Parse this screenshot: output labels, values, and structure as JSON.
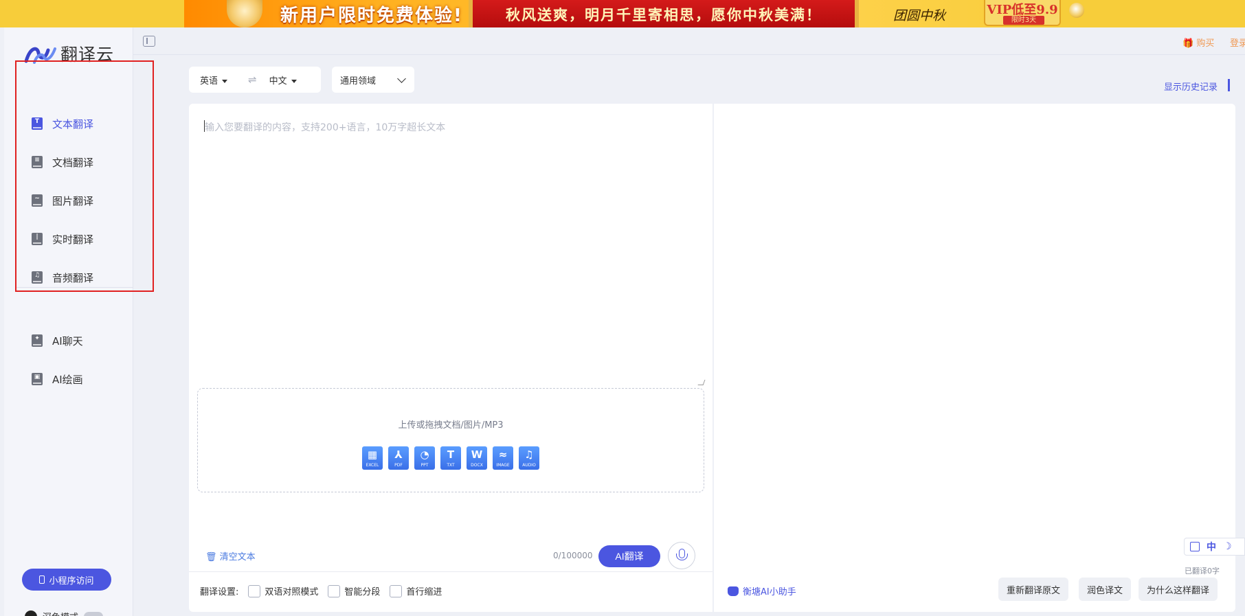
{
  "banner": {
    "title": "新用户限时免费体验!",
    "promo": "秋风送爽，明月千里寄相思，愿你中秋美满！",
    "logo": "团圆中秋",
    "vip": "VIP低至9.9",
    "vip_sub": "限时3天"
  },
  "topbar": {
    "buy": "🎁 购买",
    "login": "登录"
  },
  "app": {
    "name": "翻译云"
  },
  "sidebar": {
    "items": [
      {
        "label": "文本翻译",
        "icon": "txt-doc-icon",
        "glyph": "T"
      },
      {
        "label": "文档翻译",
        "icon": "document-icon",
        "glyph": "≡"
      },
      {
        "label": "图片翻译",
        "icon": "image-icon",
        "glyph": "~"
      },
      {
        "label": "实时翻译",
        "icon": "audio-wave-icon",
        "glyph": "|"
      },
      {
        "label": "音频翻译",
        "icon": "music-note-icon",
        "glyph": "♫"
      }
    ],
    "ai_items": [
      {
        "label": "AI聊天",
        "icon": "ai-chat-icon",
        "glyph": "✦"
      },
      {
        "label": "AI绘画",
        "icon": "ai-paint-icon",
        "glyph": "▣"
      }
    ],
    "mini_program": "小程序访问",
    "dark_mode": "深色模式"
  },
  "lang": {
    "source": "英语",
    "swap": "⇌",
    "target": "中文",
    "domain": "通用领域"
  },
  "history": "显示历史记录",
  "source_panel": {
    "placeholder": "输入您要翻译的内容，支持200+语言，10万字超长文本",
    "upload_text": "上传或拖拽文档/图片/MP3",
    "file_types": [
      {
        "label": "EXCEL",
        "glyph": "▦"
      },
      {
        "label": "PDF",
        "glyph": "⅄"
      },
      {
        "label": "PPT",
        "glyph": "◔"
      },
      {
        "label": "TXT",
        "glyph": "T"
      },
      {
        "label": "DOCX",
        "glyph": "W"
      },
      {
        "label": "IMAGE",
        "glyph": "≈"
      },
      {
        "label": "AUDIO",
        "glyph": "♫"
      }
    ],
    "clear": "🗑 清空文本",
    "count": "0/100000",
    "translate_btn": "AI翻译",
    "settings_label": "翻译设置:",
    "options": [
      "双语对照模式",
      "智能分段",
      "首行缩进"
    ]
  },
  "target_panel": {
    "tools": [
      "中",
      "☽"
    ],
    "translated_count": "已翻译0字",
    "assistant": "衡塘AI小助手",
    "buttons": [
      "重新翻译原文",
      "润色译文",
      "为什么这样翻译"
    ]
  },
  "colors": {
    "accent": "#4b56e0",
    "highlight": "#e02020",
    "orange_link": "#f09a55"
  }
}
